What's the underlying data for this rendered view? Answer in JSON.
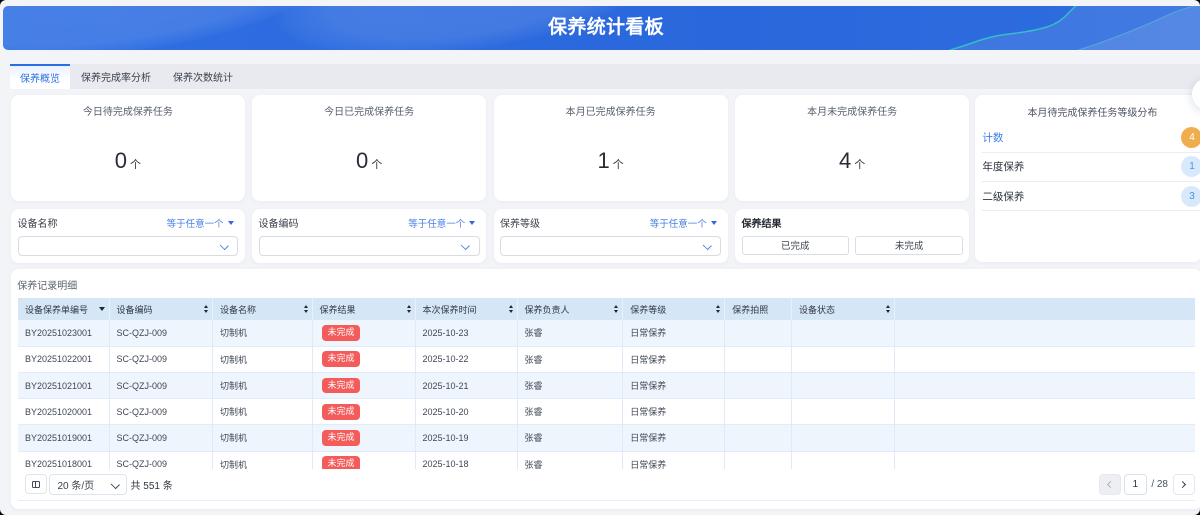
{
  "header": {
    "title": "保养统计看板"
  },
  "tabs": [
    {
      "label": "保养概览",
      "active": true
    },
    {
      "label": "保养完成率分析",
      "active": false
    },
    {
      "label": "保养次数统计",
      "active": false
    }
  ],
  "stats": [
    {
      "label": "今日待完成保养任务",
      "value": "0",
      "unit": "个"
    },
    {
      "label": "今日已完成保养任务",
      "value": "0",
      "unit": "个"
    },
    {
      "label": "本月已完成保养任务",
      "value": "1",
      "unit": "个"
    },
    {
      "label": "本月未完成保养任务",
      "value": "4",
      "unit": "个"
    }
  ],
  "level_panel": {
    "title": "本月待完成保养任务等级分布",
    "rows": [
      {
        "label": "计数",
        "value": "4",
        "style": "orange",
        "is_count": true
      },
      {
        "label": "年度保养",
        "value": "1",
        "style": "blue",
        "is_count": false
      },
      {
        "label": "二级保养",
        "value": "3",
        "style": "blue",
        "is_count": false
      }
    ]
  },
  "filters": [
    {
      "label": "设备名称",
      "operator": "等于任意一个",
      "value": ""
    },
    {
      "label": "设备编码",
      "operator": "等于任意一个",
      "value": ""
    },
    {
      "label": "保养等级",
      "operator": "等于任意一个",
      "value": ""
    }
  ],
  "result_filter": {
    "label": "保养结果",
    "options": [
      "已完成",
      "未完成"
    ]
  },
  "table": {
    "title": "保养记录明细",
    "columns": [
      {
        "label": "设备保养单编号",
        "icon": "filter"
      },
      {
        "label": "设备编码",
        "icon": "sort"
      },
      {
        "label": "设备名称",
        "icon": "sort"
      },
      {
        "label": "保养结果",
        "icon": "sort"
      },
      {
        "label": "本次保养时间",
        "icon": "sort"
      },
      {
        "label": "保养负责人",
        "icon": "sort"
      },
      {
        "label": "保养等级",
        "icon": "sort"
      },
      {
        "label": "保养拍照",
        "icon": "none"
      },
      {
        "label": "设备状态",
        "icon": "sort"
      },
      {
        "label": "",
        "icon": "none"
      }
    ],
    "rows": [
      [
        "BY20251023001",
        "SC-QZJ-009",
        "切制机",
        "未完成",
        "2025-10-23",
        "张睿",
        "日常保养",
        "",
        ""
      ],
      [
        "BY20251022001",
        "SC-QZJ-009",
        "切制机",
        "未完成",
        "2025-10-22",
        "张睿",
        "日常保养",
        "",
        ""
      ],
      [
        "BY20251021001",
        "SC-QZJ-009",
        "切制机",
        "未完成",
        "2025-10-21",
        "张睿",
        "日常保养",
        "",
        ""
      ],
      [
        "BY20251020001",
        "SC-QZJ-009",
        "切制机",
        "未完成",
        "2025-10-20",
        "张睿",
        "日常保养",
        "",
        ""
      ],
      [
        "BY20251019001",
        "SC-QZJ-009",
        "切制机",
        "未完成",
        "2025-10-19",
        "张睿",
        "日常保养",
        "",
        ""
      ],
      [
        "BY20251018001",
        "SC-QZJ-009",
        "切制机",
        "未完成",
        "2025-10-18",
        "张睿",
        "日常保养",
        "",
        ""
      ]
    ]
  },
  "footer": {
    "page_size": "20 条/页",
    "total": "共 551 条",
    "current_page": "1",
    "total_pages": "/ 28"
  }
}
